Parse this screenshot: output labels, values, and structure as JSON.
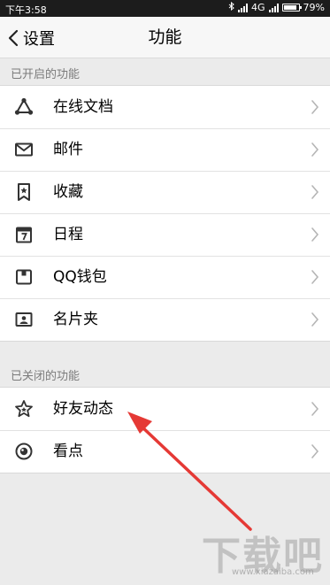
{
  "status_bar": {
    "time": "下午3:58",
    "network": "4G",
    "battery": "79%"
  },
  "nav": {
    "back_label": "设置",
    "title": "功能"
  },
  "enabled_section": {
    "header": "已开启的功能",
    "items": [
      {
        "label": "在线文档",
        "icon": "online-doc-icon"
      },
      {
        "label": "邮件",
        "icon": "mail-icon"
      },
      {
        "label": "收藏",
        "icon": "favorites-icon"
      },
      {
        "label": "日程",
        "icon": "calendar-icon"
      },
      {
        "label": "QQ钱包",
        "icon": "wallet-icon"
      },
      {
        "label": "名片夹",
        "icon": "card-holder-icon"
      }
    ]
  },
  "disabled_section": {
    "header": "已关闭的功能",
    "items": [
      {
        "label": "好友动态",
        "icon": "star-icon"
      },
      {
        "label": "看点",
        "icon": "eye-icon"
      }
    ]
  },
  "watermark": {
    "brand": "下载吧",
    "url": "www.xiazaiba.com"
  },
  "colors": {
    "annotation_arrow": "#e53935",
    "status_bar_bg": "#1c1c1c",
    "page_bg": "#ebebeb"
  }
}
